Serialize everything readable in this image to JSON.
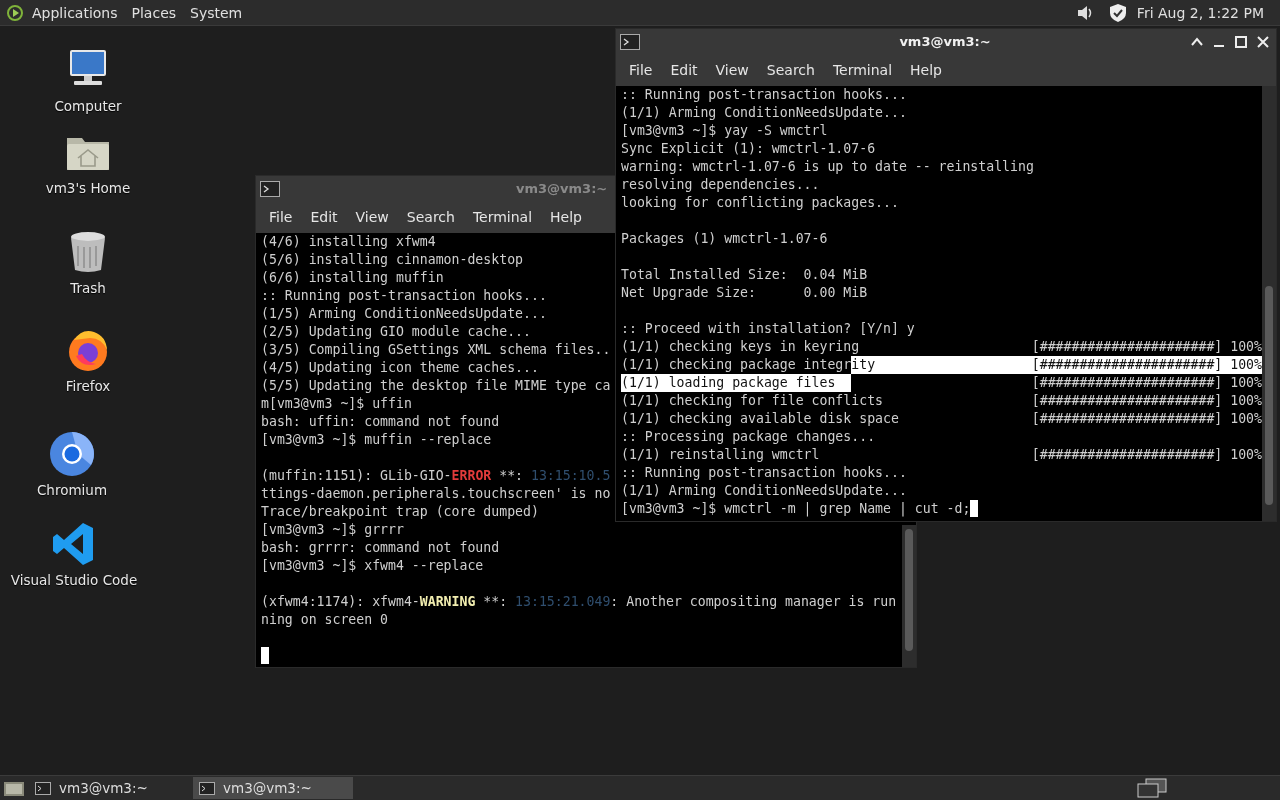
{
  "top_panel": {
    "menus": [
      "Applications",
      "Places",
      "System"
    ],
    "clock": "Fri Aug 2, 1:22 PM"
  },
  "desktop_icons": [
    {
      "label": "Computer",
      "kind": "computer"
    },
    {
      "label": "vm3's Home",
      "kind": "home"
    },
    {
      "label": "Trash",
      "kind": "trash"
    },
    {
      "label": "Firefox",
      "kind": "firefox"
    },
    {
      "label": "Chromium",
      "kind": "chromium"
    },
    {
      "label": "Visual Studio Code",
      "kind": "vscode"
    }
  ],
  "terminals": [
    {
      "title": "vm3@vm3:~",
      "active": false,
      "menus": [
        "File",
        "Edit",
        "View",
        "Search",
        "Terminal",
        "Help"
      ],
      "lines": [
        "(4/6) installing xfwm4",
        "(5/6) installing cinnamon-desktop",
        "(6/6) installing muffin",
        ":: Running post-transaction hooks...",
        "(1/5) Arming ConditionNeedsUpdate...",
        "(2/5) Updating GIO module cache...",
        "(3/5) Compiling GSettings XML schema files..",
        "(4/5) Updating icon theme caches...",
        "(5/5) Updating the desktop file MIME type ca",
        "m[vm3@vm3 ~]$ uffin",
        "bash: uffin: command not found",
        "[vm3@vm3 ~]$ muffin --replace",
        {
          "kind": "blank"
        },
        {
          "kind": "spans",
          "spans": [
            {
              "text": "(muffin:1151): GLib-GIO-",
              "kind": "plain"
            },
            {
              "text": "ERROR",
              "kind": "error"
            },
            {
              "text": " **: ",
              "kind": "plain"
            },
            {
              "text": "13:15:10.5",
              "kind": "timestamp"
            }
          ]
        },
        "ttings-daemon.peripherals.touchscreen' is no",
        "Trace/breakpoint trap (core dumped)",
        "[vm3@vm3 ~]$ grrrr",
        "bash: grrrr: command not found",
        "[vm3@vm3 ~]$ xfwm4 --replace",
        {
          "kind": "blank"
        },
        {
          "kind": "spans",
          "spans": [
            {
              "text": "(xfwm4:1174): xfwm4-",
              "kind": "plain"
            },
            {
              "text": "WARNING",
              "kind": "warning"
            },
            {
              "text": " **: ",
              "kind": "plain"
            },
            {
              "text": "13:15:21.049",
              "kind": "timestamp"
            },
            {
              "text": ": Another compositing manager is run",
              "kind": "plain"
            }
          ]
        },
        "ning on screen 0",
        {
          "kind": "blank"
        },
        {
          "kind": "blank",
          "cursor": true
        }
      ]
    },
    {
      "title": "vm3@vm3:~",
      "active": true,
      "menus": [
        "File",
        "Edit",
        "View",
        "Search",
        "Terminal",
        "Help"
      ],
      "lines": [
        ":: Running post-transaction hooks...",
        "(1/1) Arming ConditionNeedsUpdate...",
        "[vm3@vm3 ~]$ yay -S wmctrl",
        "Sync Explicit (1): wmctrl-1.07-6",
        "warning: wmctrl-1.07-6 is up to date -- reinstalling",
        "resolving dependencies...",
        "looking for conflicting packages...",
        {
          "kind": "blank"
        },
        "Packages (1) wmctrl-1.07-6",
        {
          "kind": "blank"
        },
        "Total Installed Size:  0.04 MiB",
        "Net Upgrade Size:      0.00 MiB",
        {
          "kind": "blank"
        },
        ":: Proceed with installation? [Y/n] y",
        {
          "kind": "progress",
          "text": "(1/1) checking keys in keyring",
          "bar": "[######################] 100%"
        },
        {
          "kind": "progress",
          "spans": [
            {
              "text": "(1/1) checking package integr",
              "selected": false
            },
            {
              "text": "ity",
              "selected": true
            }
          ],
          "bar": "[######################] 100%",
          "bar_selected": true
        },
        {
          "kind": "progress",
          "spans": [
            {
              "text": "(1/1) loading package files",
              "selected": true
            }
          ],
          "bar": "[######################] 100%",
          "bar_selected": false
        },
        {
          "kind": "progress",
          "text": "(1/1) checking for file conflicts",
          "bar": "[######################] 100%"
        },
        {
          "kind": "progress",
          "text": "(1/1) checking available disk space",
          "bar": "[######################] 100%"
        },
        ":: Processing package changes...",
        {
          "kind": "progress",
          "text": "(1/1) reinstalling wmctrl",
          "bar": "[######################] 100%"
        },
        ":: Running post-transaction hooks...",
        "(1/1) Arming ConditionNeedsUpdate...",
        {
          "kind": "text",
          "text": "[vm3@vm3 ~]$ wmctrl -m | grep Name | cut -d;",
          "cursor": true
        }
      ]
    }
  ],
  "taskbar": {
    "tasks": [
      {
        "label": "vm3@vm3:~",
        "selected": false
      },
      {
        "label": "vm3@vm3:~",
        "selected": true
      }
    ]
  }
}
